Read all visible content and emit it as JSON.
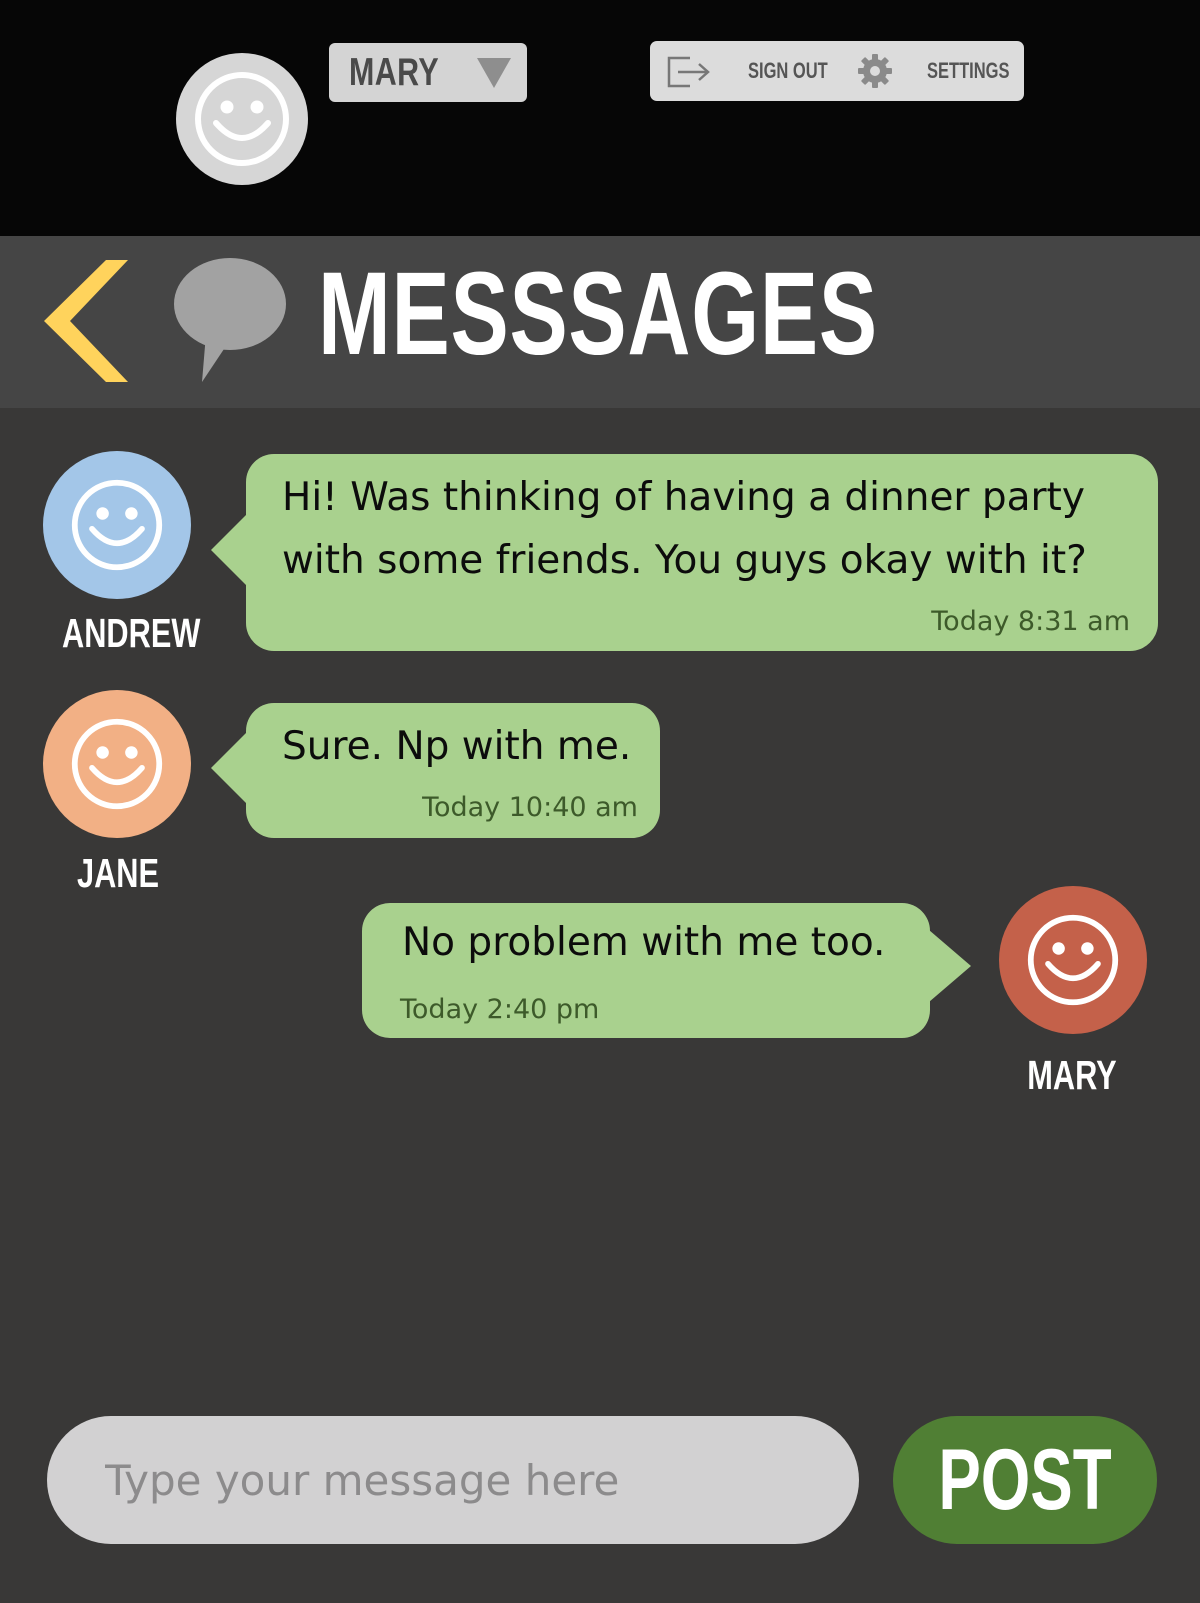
{
  "account": {
    "current_user": "MARY",
    "sign_out_label": "SIGN OUT",
    "settings_label": "SETTINGS"
  },
  "header": {
    "title": "MESSSAGES"
  },
  "messages": [
    {
      "sender": "ANDREW",
      "avatar_color": "#a3c6e8",
      "text": "Hi! Was thinking of having a dinner party with some friends. You guys okay with it?",
      "time": "Today 8:31 am"
    },
    {
      "sender": "JANE",
      "avatar_color": "#f2b085",
      "text": "Sure. Np with me.",
      "time": "Today 10:40 am"
    },
    {
      "sender": "MARY",
      "avatar_color": "#c4614a",
      "text": "No problem with me too.",
      "time": "Today 2:40 pm"
    }
  ],
  "composer": {
    "placeholder": "Type your message here",
    "post_label": "POST"
  },
  "colors": {
    "bubble": "#a9d18e",
    "accent_back": "#ffd35c",
    "post_button": "#507f34"
  }
}
